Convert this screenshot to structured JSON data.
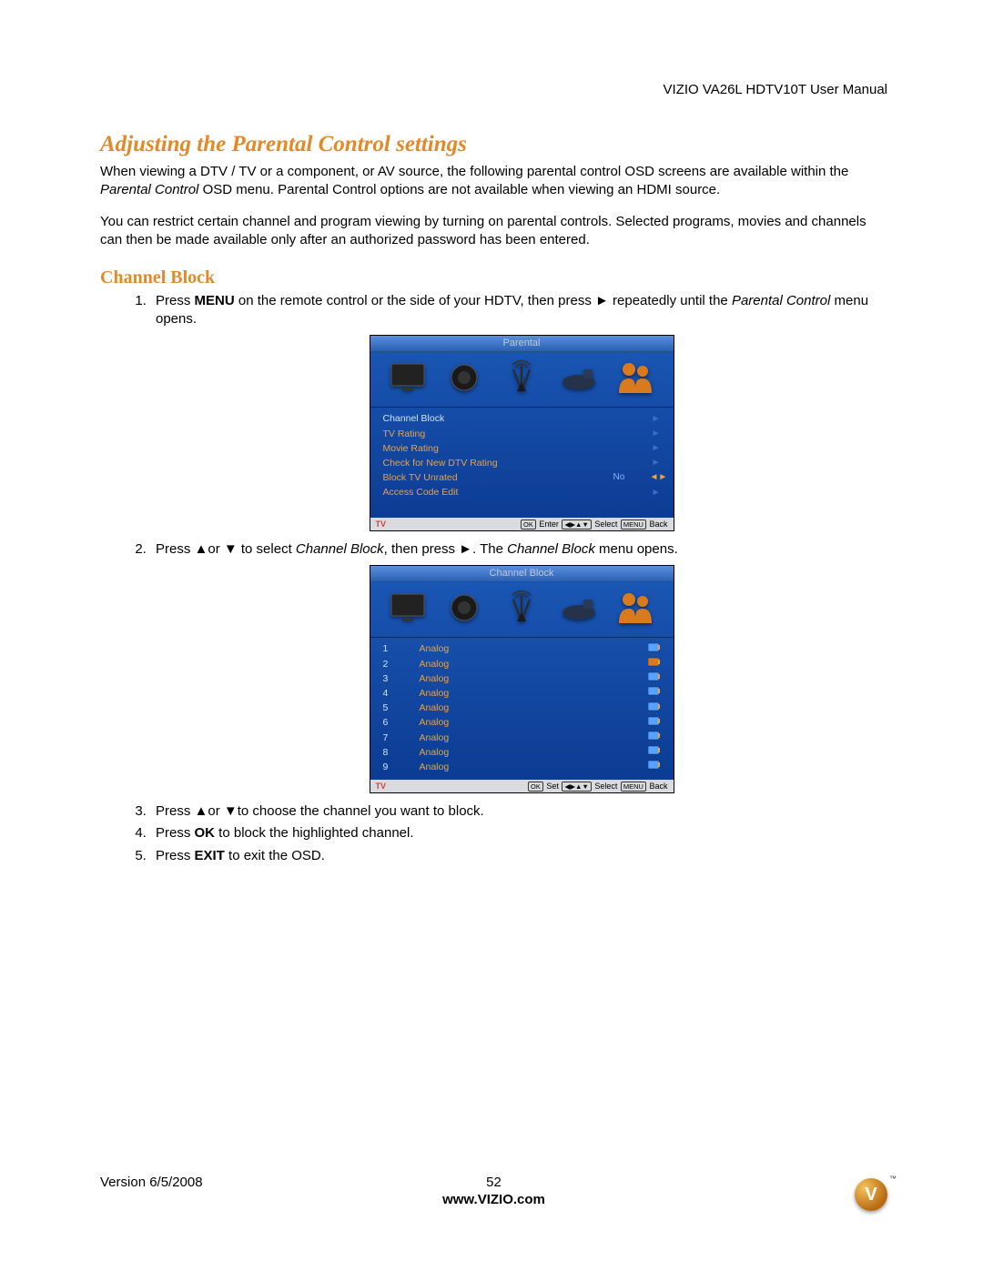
{
  "header": {
    "product": "VIZIO VA26L HDTV10T User Manual"
  },
  "section_title": "Adjusting the Parental Control settings",
  "intro": {
    "p1a": "When viewing a DTV / TV or a component, or AV source, the following parental control OSD screens are available within the ",
    "p1_em": "Parental Control",
    "p1b": " OSD menu. Parental Control options are not available when viewing an HDMI source.",
    "p2": "You can restrict certain channel and program viewing by turning on parental controls. Selected programs, movies and channels can then be made available only after an authorized password has been entered."
  },
  "subsection_title": "Channel Block",
  "steps": {
    "s1a": "Press ",
    "s1_bold": "MENU",
    "s1b": " on the remote control or the side of your HDTV, then press ► repeatedly until the ",
    "s1_em": "Parental Control",
    "s1c": " menu opens.",
    "s2a": "Press ▲or ▼ to select ",
    "s2_em1": "Channel Block",
    "s2b": ", then press ►. The ",
    "s2_em2": "Channel Block",
    "s2c": " menu opens.",
    "s3": "Press ▲or ▼to choose the channel you want to block.",
    "s4a": "Press ",
    "s4_bold": "OK",
    "s4b": " to block the highlighted channel.",
    "s5a": "Press ",
    "s5_bold": "EXIT",
    "s5b": " to exit the OSD."
  },
  "osd1": {
    "title": "Parental",
    "items": [
      {
        "label": "Channel Block",
        "val": "",
        "arrow": "►",
        "hl": true
      },
      {
        "label": "TV Rating",
        "val": "",
        "arrow": "►"
      },
      {
        "label": "Movie Rating",
        "val": "",
        "arrow": "►"
      },
      {
        "label": "Check for New DTV Rating",
        "val": "",
        "arrow": "►"
      },
      {
        "label": "Block TV Unrated",
        "val": "No",
        "arrow": "◄►"
      },
      {
        "label": "Access Code Edit",
        "val": "",
        "arrow": "►"
      }
    ],
    "footer": {
      "tv": "TV",
      "ok": "OK",
      "enter": "Enter",
      "select": "Select",
      "menu": "MENU",
      "back": "Back"
    }
  },
  "osd2": {
    "title": "Channel Block",
    "channels": [
      {
        "n": "1",
        "t": "Analog",
        "blocked": false
      },
      {
        "n": "2",
        "t": "Analog",
        "blocked": true
      },
      {
        "n": "3",
        "t": "Analog",
        "blocked": false
      },
      {
        "n": "4",
        "t": "Analog",
        "blocked": false
      },
      {
        "n": "5",
        "t": "Analog",
        "blocked": false
      },
      {
        "n": "6",
        "t": "Analog",
        "blocked": false
      },
      {
        "n": "7",
        "t": "Analog",
        "blocked": false
      },
      {
        "n": "8",
        "t": "Analog",
        "blocked": false
      },
      {
        "n": "9",
        "t": "Analog",
        "blocked": false
      }
    ],
    "footer": {
      "tv": "TV",
      "ok": "OK",
      "set": "Set",
      "select": "Select",
      "menu": "MENU",
      "back": "Back"
    }
  },
  "page_footer": {
    "version": "Version 6/5/2008",
    "page": "52",
    "url": "www.VIZIO.com",
    "logo_letter": "V"
  }
}
